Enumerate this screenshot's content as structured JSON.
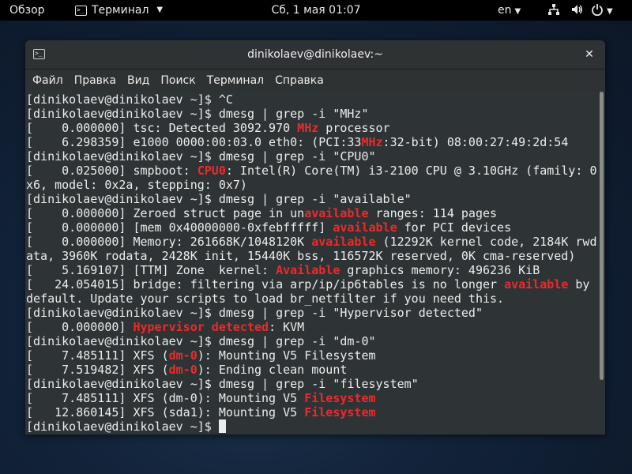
{
  "topbar": {
    "activities": "Обзор",
    "app_name": "Терминал",
    "clock": "Сб, 1 мая  01:07",
    "language": "en"
  },
  "window": {
    "title": "dinikolaev@dinikolaev:~",
    "close_symbol": "✕"
  },
  "menu": [
    "Файл",
    "Правка",
    "Вид",
    "Поиск",
    "Терминал",
    "Справка"
  ],
  "terminal": {
    "lines": [
      [
        [
          "[dinikolaev@dinikolaev ~]$ ^C",
          0
        ]
      ],
      [
        [
          "[dinikolaev@dinikolaev ~]$ dmesg | grep -i \"MHz\"",
          0
        ]
      ],
      [
        [
          "[    0.000000] tsc: Detected 3092.970 ",
          0
        ],
        [
          "MHz",
          1
        ],
        [
          " processor",
          0
        ]
      ],
      [
        [
          "[    6.298359] e1000 0000:00:03.0 eth0: (PCI:33",
          0
        ],
        [
          "MHz",
          1
        ],
        [
          ":32-bit) 08:00:27:49:2d:54",
          0
        ]
      ],
      [
        [
          "[dinikolaev@dinikolaev ~]$ dmesg | grep -i \"CPU0\"",
          0
        ]
      ],
      [
        [
          "[    0.025000] smpboot: ",
          0
        ],
        [
          "CPU0",
          1
        ],
        [
          ": Intel(R) Core(TM) i3-2100 CPU @ 3.10GHz (family: 0",
          0
        ]
      ],
      [
        [
          "x6, model: 0x2a, stepping: 0x7)",
          0
        ]
      ],
      [
        [
          "[dinikolaev@dinikolaev ~]$ dmesg | grep -i \"available\"",
          0
        ]
      ],
      [
        [
          "[    0.000000] Zeroed struct page in un",
          0
        ],
        [
          "available",
          1
        ],
        [
          " ranges: 114 pages",
          0
        ]
      ],
      [
        [
          "[    0.000000] [mem 0x40000000-0xfebfffff] ",
          0
        ],
        [
          "available",
          1
        ],
        [
          " for PCI devices",
          0
        ]
      ],
      [
        [
          "[    0.000000] Memory: 261668K/1048120K ",
          0
        ],
        [
          "available",
          1
        ],
        [
          " (12292K kernel code, 2184K rwd",
          0
        ]
      ],
      [
        [
          "ata, 3960K rodata, 2428K init, 15440K bss, 116572K reserved, 0K cma-reserved)",
          0
        ]
      ],
      [
        [
          "[    5.169107] [TTM] Zone  kernel: ",
          0
        ],
        [
          "Available",
          1
        ],
        [
          " graphics memory: 496236 KiB",
          0
        ]
      ],
      [
        [
          "[   24.054015] bridge: filtering via arp/ip/ip6tables is no longer ",
          0
        ],
        [
          "available",
          1
        ],
        [
          " by",
          0
        ]
      ],
      [
        [
          "default. Update your scripts to load br_netfilter if you need this.",
          0
        ]
      ],
      [
        [
          "[dinikolaev@dinikolaev ~]$ dmesg | grep -i \"Hypervisor detected\"",
          0
        ]
      ],
      [
        [
          "[    0.000000] ",
          0
        ],
        [
          "Hypervisor detected",
          1
        ],
        [
          ": KVM",
          0
        ]
      ],
      [
        [
          "[dinikolaev@dinikolaev ~]$ dmesg | grep -i \"dm-0\"",
          0
        ]
      ],
      [
        [
          "[    7.485111] XFS (",
          0
        ],
        [
          "dm-0",
          1
        ],
        [
          "): Mounting V5 Filesystem",
          0
        ]
      ],
      [
        [
          "[    7.519482] XFS (",
          0
        ],
        [
          "dm-0",
          1
        ],
        [
          "): Ending clean mount",
          0
        ]
      ],
      [
        [
          "[dinikolaev@dinikolaev ~]$ dmesg | grep -i \"filesystem\"",
          0
        ]
      ],
      [
        [
          "[    7.485111] XFS (dm-0): Mounting V5 ",
          0
        ],
        [
          "Filesystem",
          1
        ]
      ],
      [
        [
          "[   12.860145] XFS (sda1): Mounting V5 ",
          0
        ],
        [
          "Filesystem",
          1
        ]
      ],
      [
        [
          "[dinikolaev@dinikolaev ~]$ ",
          0
        ]
      ]
    ]
  },
  "colors": {
    "highlight": "#ef2929",
    "terminal_bg": "#2e3436",
    "terminal_fg": "#ececec"
  },
  "icons": [
    "terminal-icon",
    "chevron-down-icon",
    "network-icon",
    "volume-icon",
    "power-icon",
    "close-icon"
  ]
}
